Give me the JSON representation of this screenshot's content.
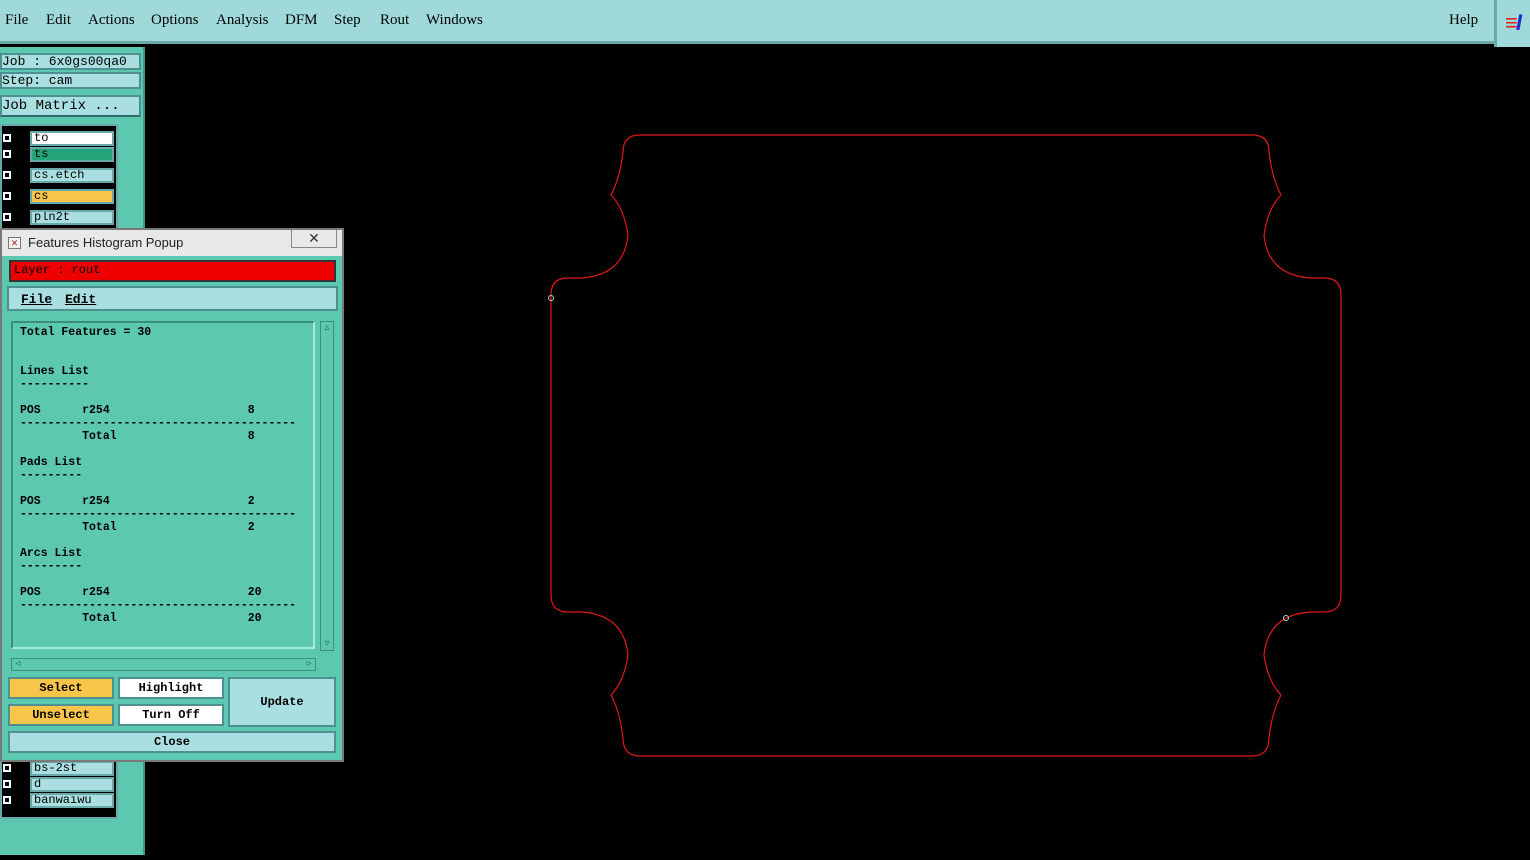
{
  "menubar": {
    "items": [
      "File",
      "Edit",
      "Actions",
      "Options",
      "Analysis",
      "DFM",
      "Step",
      "Rout",
      "Windows"
    ],
    "help": "Help"
  },
  "sidebar": {
    "job": "Job : 6x0gs00qa0",
    "step": "Step: cam",
    "job_matrix": "Job Matrix ...",
    "layers_top": [
      {
        "name": "to",
        "color": "#ffffff"
      },
      {
        "name": "ts",
        "color": "#22a37a"
      },
      {
        "name": "cs.etch",
        "color": "#a9dfe0"
      },
      {
        "name": "cs",
        "color": "#f7c54a"
      },
      {
        "name": "pln2t",
        "color": "#a9dfe0"
      }
    ],
    "layers_bottom": [
      {
        "name": "bs-2st",
        "color": "#a9dfe0"
      },
      {
        "name": "d",
        "color": "#a9dfe0"
      },
      {
        "name": "banwaiwu",
        "color": "#a9dfe0"
      }
    ]
  },
  "popup": {
    "title": "Features Histogram Popup",
    "close_glyph": "✕",
    "layer_label": "Layer : rout",
    "menu": {
      "file": "File",
      "edit": "Edit"
    },
    "lines": [
      "Total Features = 30",
      "",
      "",
      "Lines List",
      "----------",
      "",
      "POS      r254                    8",
      "----------------------------------------",
      "         Total                   8",
      "",
      "Pads List",
      "---------",
      "",
      "POS      r254                    2",
      "----------------------------------------",
      "         Total                   2",
      "",
      "Arcs List",
      "---------",
      "",
      "POS      r254                    20",
      "----------------------------------------",
      "         Total                   20"
    ],
    "buttons": {
      "select": "Select",
      "unselect": "Unselect",
      "highlight": "Highlight",
      "turn_off": "Turn Off",
      "update": "Update",
      "close": "Close"
    }
  },
  "colors": {
    "menubar": "#9fd9d9",
    "panel": "#5cc8b0",
    "layer_active": "#ee0000",
    "outline": "#e01818",
    "canvas": "#000000"
  }
}
